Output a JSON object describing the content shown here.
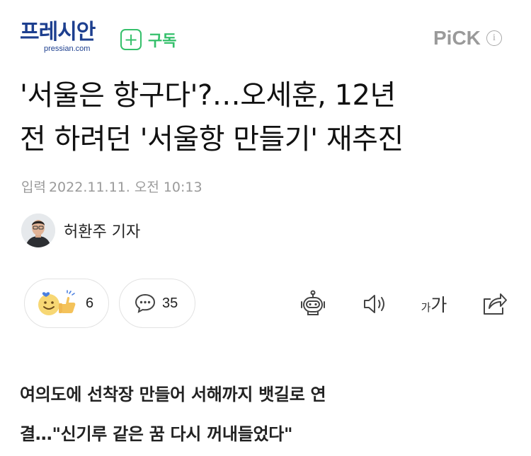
{
  "header": {
    "logo_main": "프레시안",
    "logo_sub": "pressian.com",
    "subscribe_label": "구독",
    "pick_label": "PiCK",
    "pick_info_symbol": "i"
  },
  "article": {
    "headline_line1": "'서울은 항구다'?…오세훈, 12년",
    "headline_line2": "전 하려던 '서울항 만들기' 재추진",
    "date_label": "입력",
    "date_value": "2022.11.11. 오전 10:13",
    "reporter_name": "허환주 기자",
    "subheadline_line1": "여의도에 선착장 만들어 서해까지 뱃길로 연",
    "subheadline_line2": "결…\"신기루 같은 꿈 다시 꺼내들었다\""
  },
  "actions": {
    "reaction_count": "6",
    "comment_count": "35",
    "font_small": "가",
    "font_large": "가"
  },
  "icons": {
    "subscribe": "plus-icon",
    "reaction": "smile-thumbs-up-icon",
    "comment": "speech-bubble-icon",
    "summary": "robot-icon",
    "tts": "speaker-icon",
    "share": "share-icon"
  },
  "colors": {
    "brand": "#1d3f8f",
    "subscribe_green": "#35c06b",
    "muted_gray": "#9a9a9a",
    "border": "#e2e2e2"
  }
}
